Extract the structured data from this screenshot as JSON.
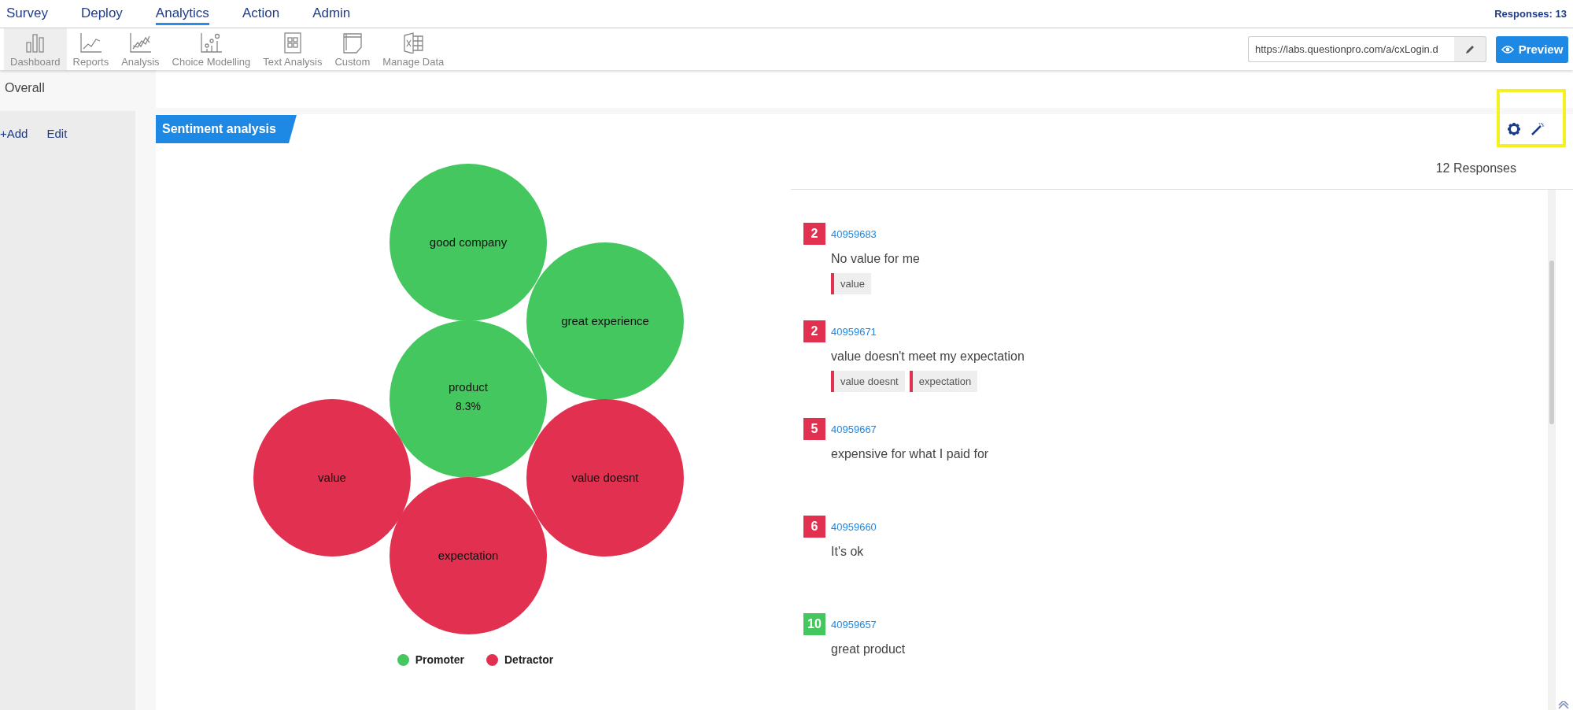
{
  "top_nav": {
    "tabs": [
      {
        "label": "Survey",
        "selected": false
      },
      {
        "label": "Deploy",
        "selected": false
      },
      {
        "label": "Analytics",
        "selected": true
      },
      {
        "label": "Action",
        "selected": false
      },
      {
        "label": "Admin",
        "selected": false
      }
    ],
    "responses_count": "Responses: 13"
  },
  "toolbar": {
    "items": [
      {
        "label": "Dashboard",
        "kind": "bars",
        "selected": true
      },
      {
        "label": "Reports",
        "kind": "line",
        "selected": false
      },
      {
        "label": "Analysis",
        "kind": "multiline",
        "selected": false
      },
      {
        "label": "Choice Modelling",
        "kind": "scatter",
        "selected": false
      },
      {
        "label": "Text Analysis",
        "kind": "grid",
        "selected": false
      },
      {
        "label": "Custom",
        "kind": "page",
        "selected": false
      },
      {
        "label": "Manage Data",
        "kind": "sheet",
        "selected": false
      }
    ],
    "url_field": {
      "value": "https://labs.questionpro.com/a/cxLogin.d"
    },
    "preview_button": {
      "label": "Preview"
    }
  },
  "sidebar": {
    "title": "Overall",
    "actions": [
      "+Add",
      "Edit"
    ]
  },
  "card": {
    "title": "Sentiment analysis",
    "bubbles": [
      {
        "label": "good company",
        "color": "#44c75f"
      },
      {
        "label": "great experience",
        "color": "#44c75f"
      },
      {
        "label": "product",
        "percent": "8.3%",
        "color": "#44c75f"
      },
      {
        "label": "value",
        "color": "#e23050"
      },
      {
        "label": "value doesnt",
        "color": "#e23050"
      },
      {
        "label": "expectation",
        "color": "#e23050"
      }
    ],
    "legend": [
      {
        "label": "Promoter",
        "color": "#44c75f"
      },
      {
        "label": "Detractor",
        "color": "#e23050"
      }
    ],
    "responses_heading": "12 Responses",
    "responses": [
      {
        "score": "2",
        "color": "#e23050",
        "id": "40959683",
        "text": "No value for me",
        "tags": [
          {
            "label": "value",
            "color": "#e23050"
          }
        ]
      },
      {
        "score": "2",
        "color": "#e23050",
        "id": "40959671",
        "text": "value doesn't meet my expectation",
        "tags": [
          {
            "label": "value doesnt",
            "color": "#e23050"
          },
          {
            "label": "expectation",
            "color": "#e23050"
          }
        ]
      },
      {
        "score": "5",
        "color": "#e23050",
        "id": "40959667",
        "text": "expensive for what I paid for"
      },
      {
        "score": "6",
        "color": "#e23050",
        "id": "40959660",
        "text": "It's ok"
      },
      {
        "score": "10",
        "color": "#44c75f",
        "id": "40959657",
        "text": "great product"
      }
    ]
  }
}
